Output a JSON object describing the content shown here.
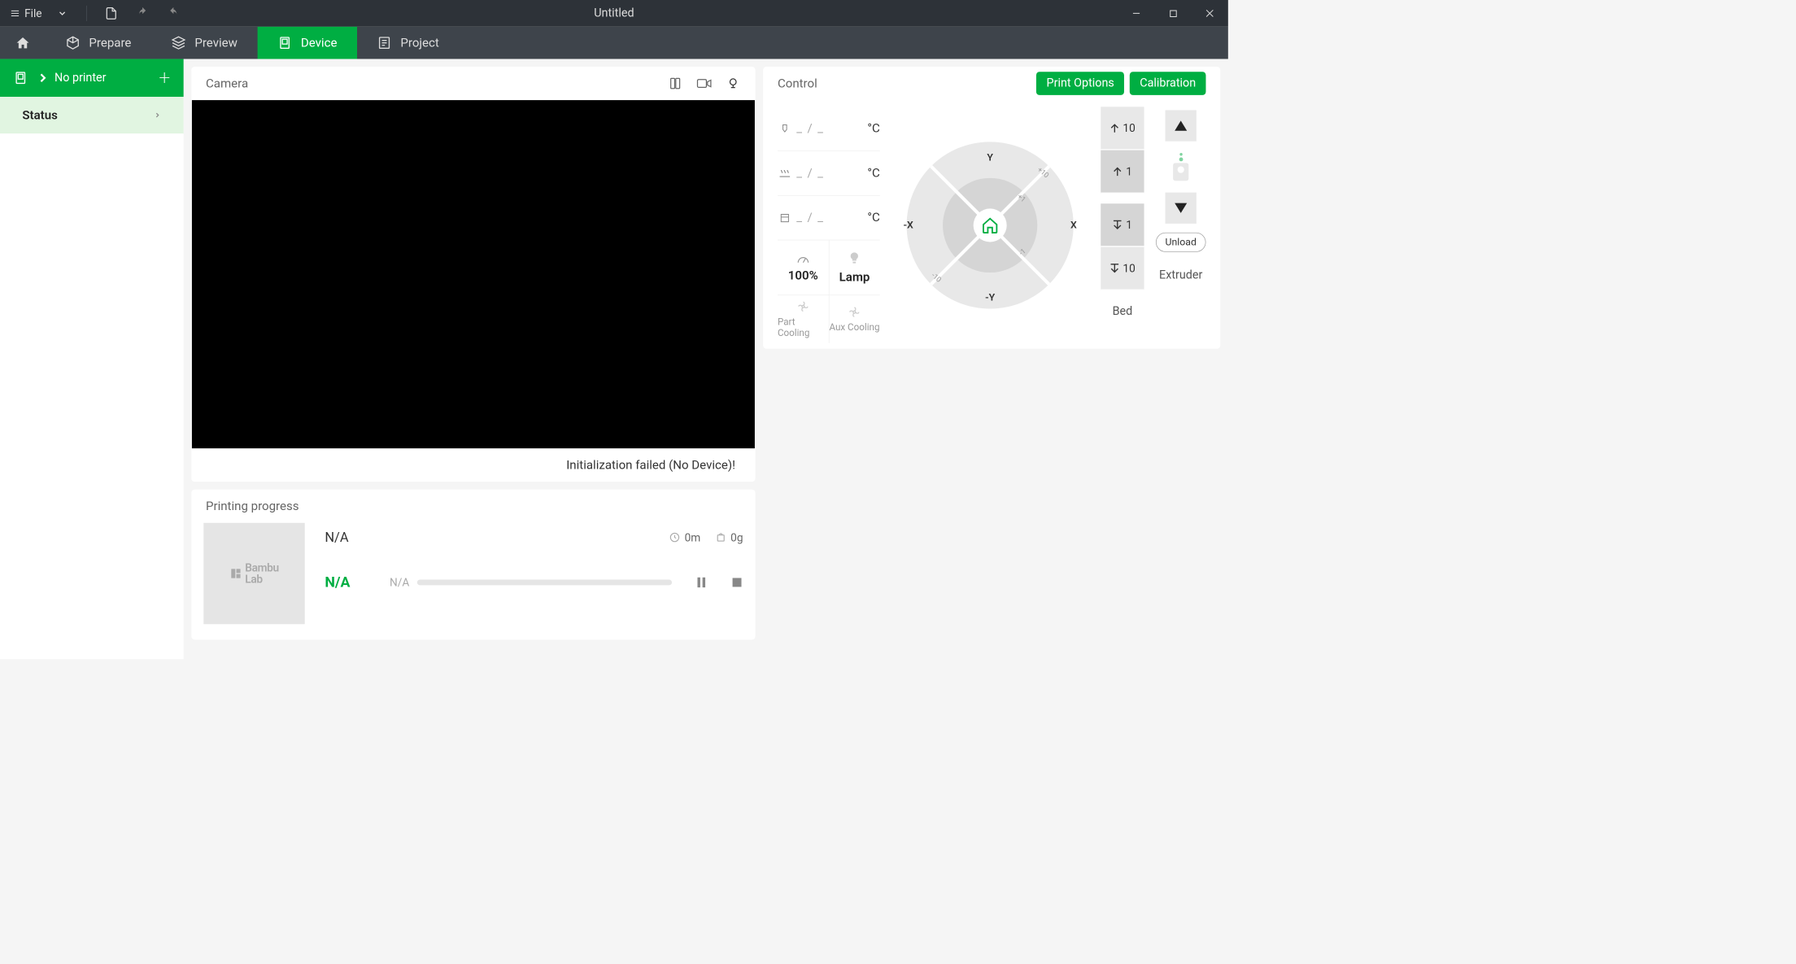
{
  "titlebar": {
    "file_label": "File",
    "document_title": "Untitled"
  },
  "tabs": {
    "prepare": "Prepare",
    "preview": "Preview",
    "device": "Device",
    "project": "Project"
  },
  "sidebar": {
    "printer_name": "No printer",
    "status_label": "Status"
  },
  "camera": {
    "title": "Camera",
    "status_message": "Initialization failed (No Device)!"
  },
  "progress": {
    "title": "Printing progress",
    "thumb_brand": "Bambu Lab",
    "job_name": "N/A",
    "time": "0m",
    "weight": "0g",
    "percent": "N/A",
    "layers": "N/A"
  },
  "control": {
    "title": "Control",
    "print_options": "Print Options",
    "calibration": "Calibration",
    "temp_placeholder": "_ / _",
    "temp_unit": "°C",
    "speed_pct": "100%",
    "lamp": "Lamp",
    "part_cooling": "Part Cooling",
    "aux_cooling": "Aux Cooling",
    "axis_y": "Y",
    "axis_ny": "-Y",
    "axis_x": "X",
    "axis_nx": "-X",
    "step_p10": "+10",
    "step_p1": "+1",
    "step_n1": "-1",
    "step_n10": "-10",
    "bed_10": "10",
    "bed_1": "1",
    "bed_label": "Bed",
    "extruder_label": "Extruder",
    "unload": "Unload"
  }
}
